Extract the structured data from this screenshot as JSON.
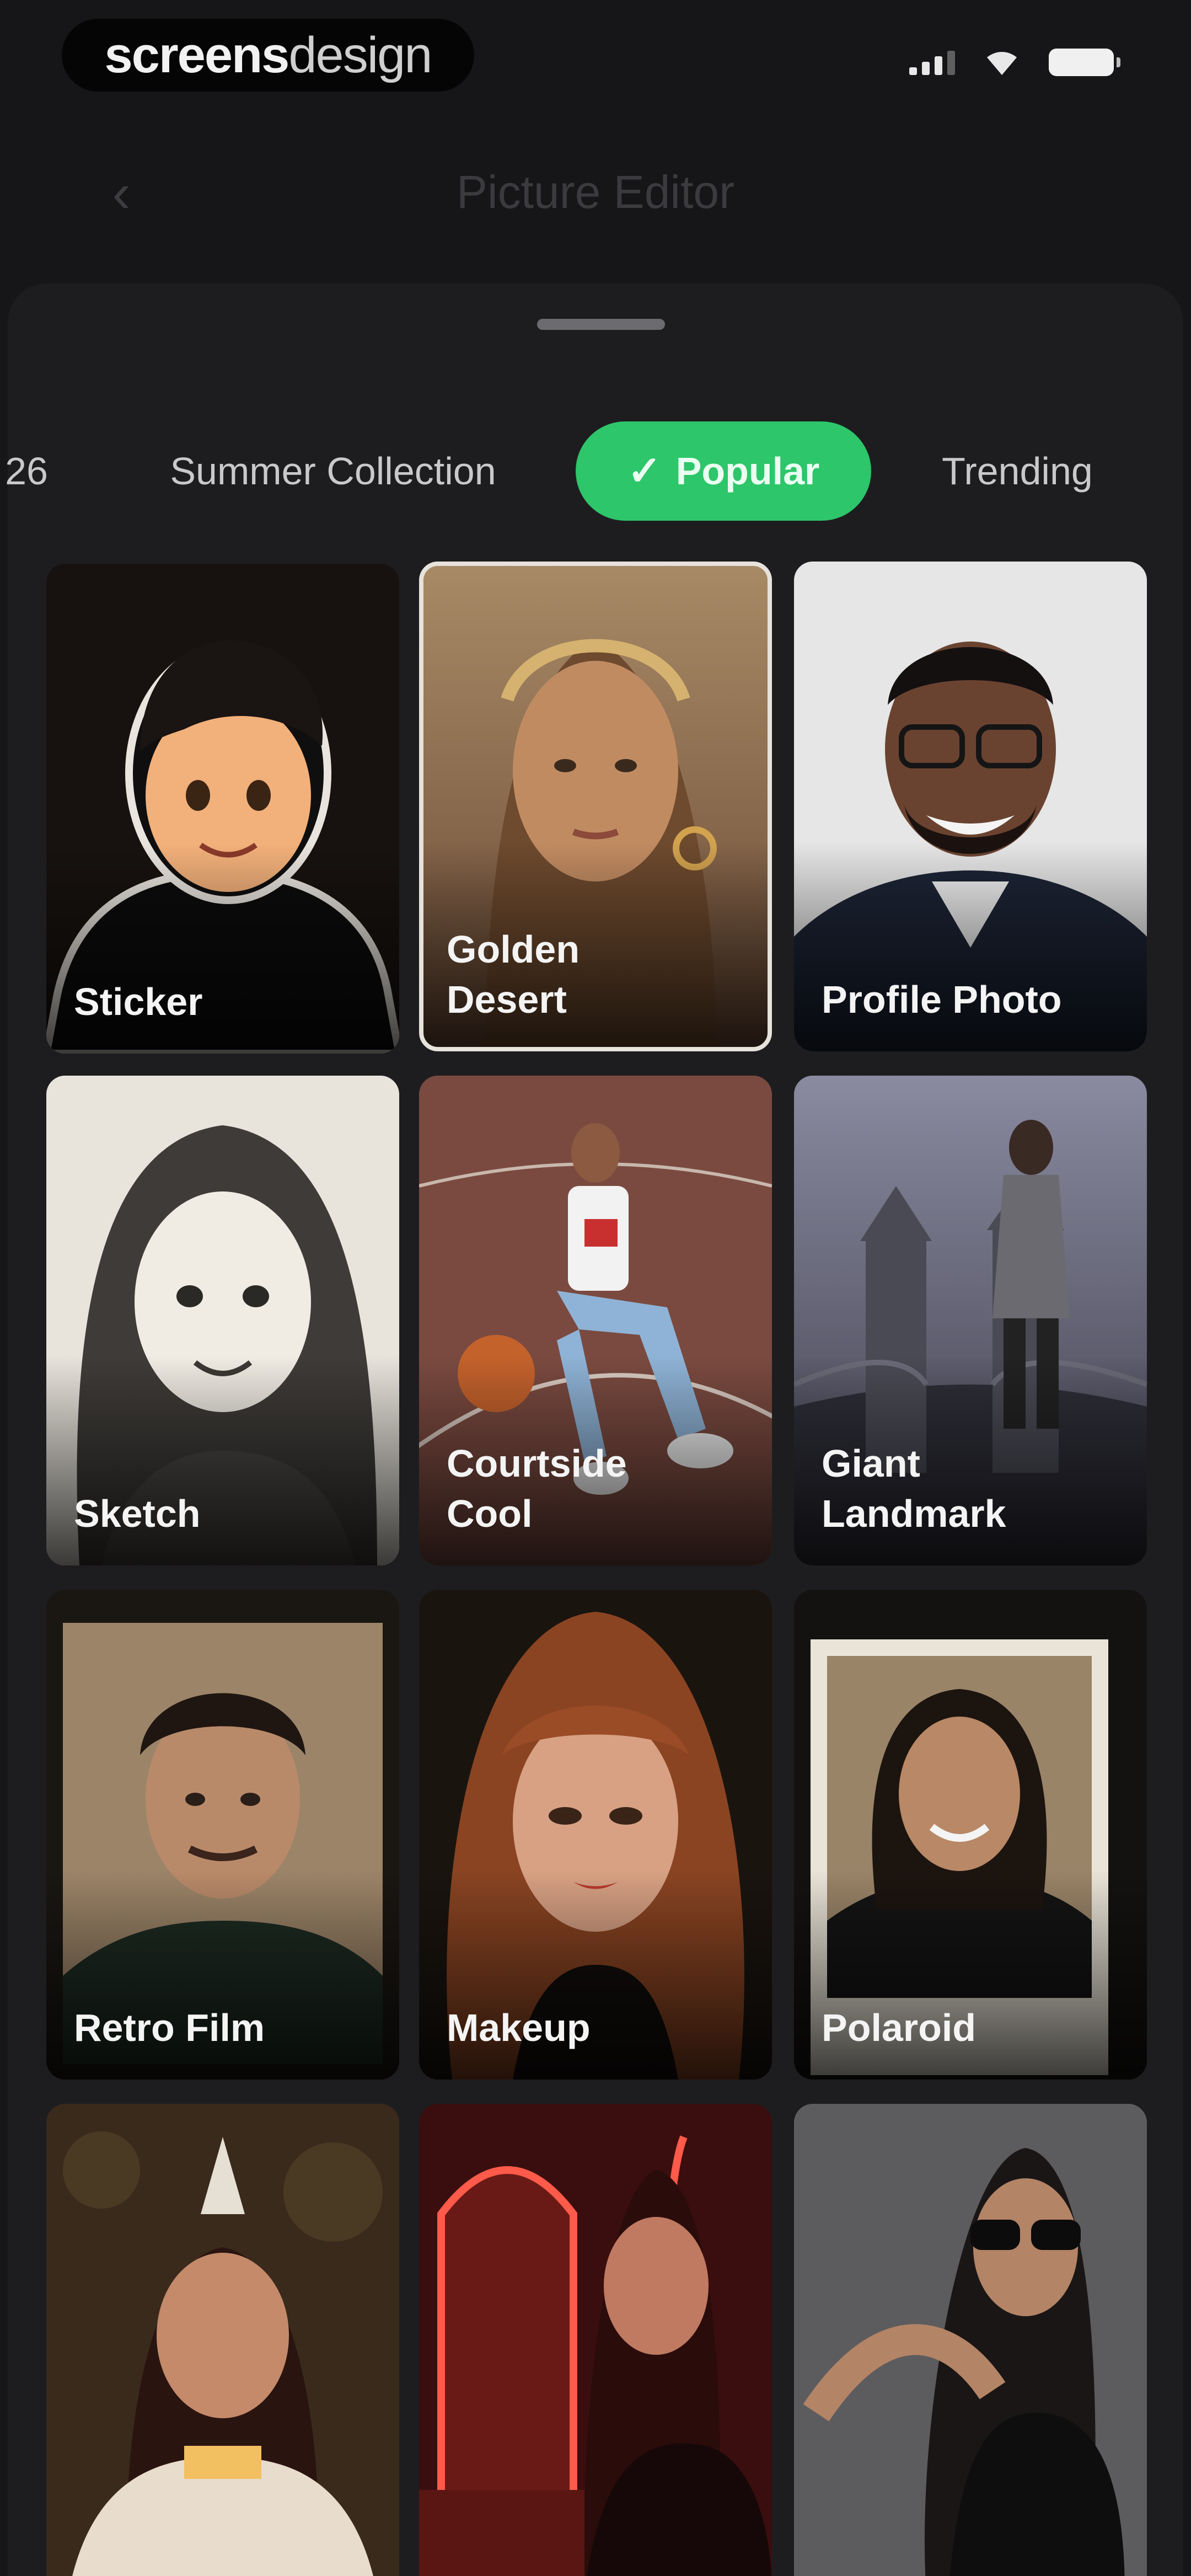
{
  "status_bar": {
    "brand_part1": "screens",
    "brand_part2": "design",
    "icons": [
      "cellular-signal-icon",
      "wifi-icon",
      "battery-icon"
    ]
  },
  "header": {
    "title": "Picture Editor",
    "back_icon": "chevron-left-icon",
    "back_glyph": "‹"
  },
  "tabs": [
    {
      "label": "26"
    },
    {
      "label": "Summer Collection"
    },
    {
      "label": "Popular",
      "selected": true,
      "check_glyph": "✓"
    },
    {
      "label": "Trending"
    }
  ],
  "accent_color": "#2dc66a",
  "styles": [
    {
      "label": "Sticker"
    },
    {
      "label": "Golden Desert",
      "selected": true
    },
    {
      "label": "Profile Photo"
    },
    {
      "label": "Sketch"
    },
    {
      "label": "Courtside Cool"
    },
    {
      "label": "Giant Landmark"
    },
    {
      "label": "Retro Film"
    },
    {
      "label": "Makeup"
    },
    {
      "label": "Polaroid"
    },
    {
      "label": ""
    },
    {
      "label": ""
    },
    {
      "label": ""
    }
  ]
}
